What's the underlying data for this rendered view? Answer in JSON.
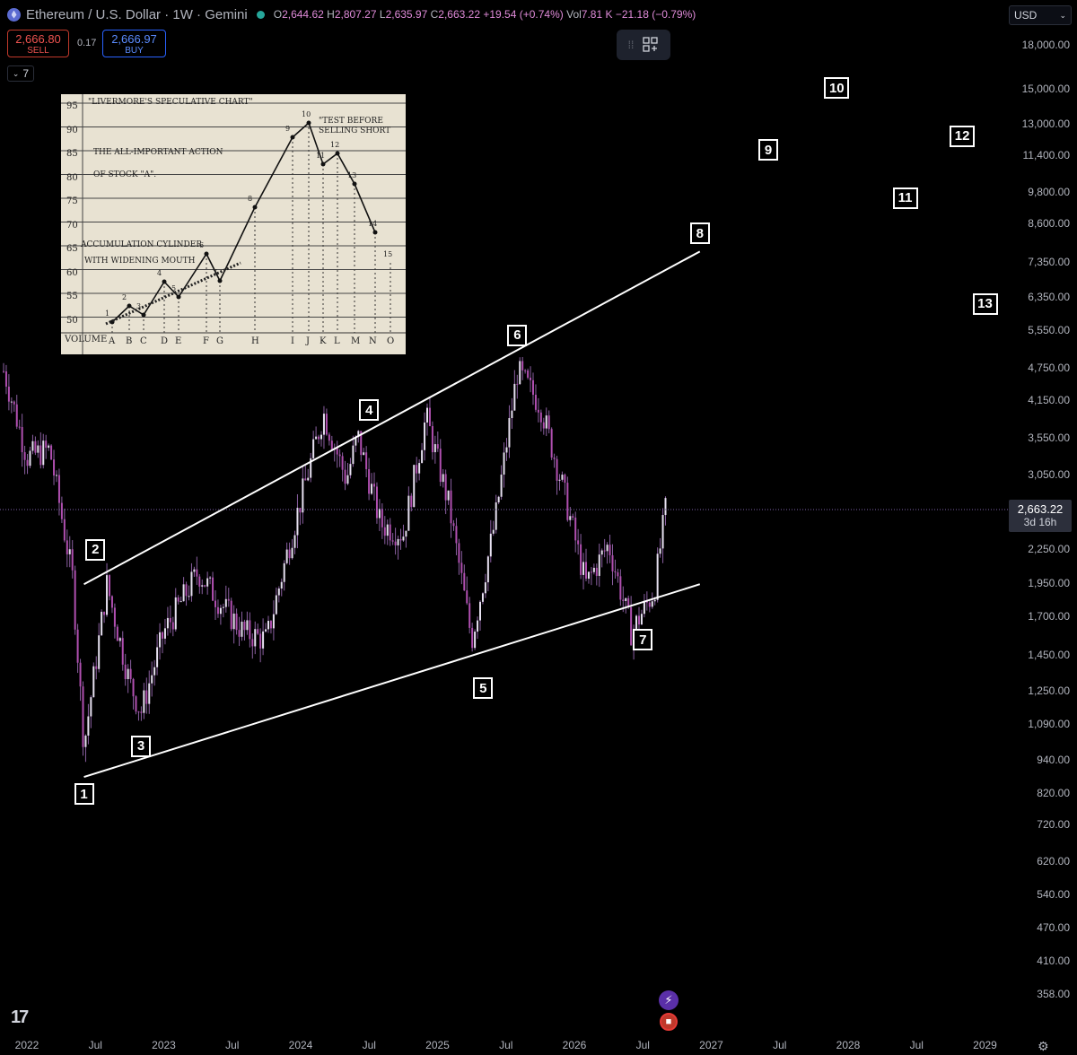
{
  "header": {
    "title": "Ethereum / U.S. Dollar · 1W · Gemini",
    "open_label": "O",
    "open": "2,644.62",
    "high_label": "H",
    "high": "2,807.27",
    "low_label": "L",
    "low": "2,635.97",
    "close_label": "C",
    "close": "2,663.22",
    "change": "+19.54 (+0.74%)",
    "vol_label": "Vol",
    "vol": "7.81 K",
    "vol_change": "−21.18 (−0.79%)"
  },
  "trade": {
    "sell_price": "2,666.80",
    "sell_label": "SELL",
    "spread": "0.17",
    "buy_price": "2,666.97",
    "buy_label": "BUY"
  },
  "indicators_count": "7",
  "currency": "USD",
  "current_price": {
    "value": "2,663.22",
    "countdown": "3d 16h"
  },
  "colors": {
    "background": "#000000",
    "candle": "#b04fb0",
    "line": "#ffffff",
    "accent": "#2962ff"
  },
  "chart_data": {
    "type": "candlestick",
    "y_scale": "log",
    "y_ticks": [
      "18,000.00",
      "15,000.00",
      "13,000.00",
      "11,400.00",
      "9,800.00",
      "8,600.00",
      "7,350.00",
      "6,350.00",
      "5,550.00",
      "4,750.00",
      "4,150.00",
      "3,550.00",
      "3,050.00",
      "2,250.00",
      "1,950.00",
      "1,700.00",
      "1,450.00",
      "1,250.00",
      "1,090.00",
      "940.00",
      "820.00",
      "720.00",
      "620.00",
      "540.00",
      "470.00",
      "410.00",
      "358.00"
    ],
    "x_ticks": [
      "2022",
      "Jul",
      "2023",
      "Jul",
      "2024",
      "Jul",
      "2025",
      "Jul",
      "2026",
      "Jul",
      "2027",
      "Jul",
      "2028",
      "Jul",
      "2029"
    ],
    "price_path": [
      [
        "2021-11",
        4700
      ],
      [
        "2022-01",
        3300
      ],
      [
        "2022-03",
        3400
      ],
      [
        "2022-05",
        2000
      ],
      [
        "2022-06",
        1000
      ],
      [
        "2022-08",
        1950
      ],
      [
        "2022-10",
        1300
      ],
      [
        "2022-11",
        1150
      ],
      [
        "2023-01",
        1600
      ],
      [
        "2023-04",
        2050
      ],
      [
        "2023-06",
        1800
      ],
      [
        "2023-08",
        1600
      ],
      [
        "2023-10",
        1550
      ],
      [
        "2023-12",
        2300
      ],
      [
        "2024-03",
        3950
      ],
      [
        "2024-05",
        3000
      ],
      [
        "2024-06",
        3600
      ],
      [
        "2024-08",
        2500
      ],
      [
        "2024-10",
        2400
      ],
      [
        "2024-12",
        3900
      ],
      [
        "2025-02",
        2700
      ],
      [
        "2025-04",
        1550
      ],
      [
        "2025-06",
        2500
      ],
      [
        "2025-08",
        4700
      ],
      [
        "2025-10",
        4100
      ],
      [
        "2025-12",
        2900
      ],
      [
        "2026-02",
        1950
      ],
      [
        "2026-04",
        2300
      ],
      [
        "2026-06",
        1600
      ],
      [
        "2026-08",
        1900
      ],
      [
        "2026-09",
        2663
      ]
    ],
    "trend_lines": [
      {
        "name": "upper",
        "from": [
          "2022-06",
          1950
        ],
        "to": [
          "2026-12",
          7700
        ]
      },
      {
        "name": "lower",
        "from": [
          "2022-06",
          880
        ],
        "to": [
          "2026-12",
          1950
        ]
      }
    ],
    "wave_labels": [
      {
        "label": "1",
        "date": "2022-06",
        "price": 820
      },
      {
        "label": "2",
        "date": "2022-07",
        "price": 2250
      },
      {
        "label": "3",
        "date": "2022-11",
        "price": 1000
      },
      {
        "label": "4",
        "date": "2024-07",
        "price": 4000
      },
      {
        "label": "5",
        "date": "2025-05",
        "price": 1270
      },
      {
        "label": "6",
        "date": "2025-08",
        "price": 5450
      },
      {
        "label": "7",
        "date": "2026-07",
        "price": 1550
      },
      {
        "label": "8",
        "date": "2026-12",
        "price": 8300
      },
      {
        "label": "9",
        "date": "2027-06",
        "price": 11700
      },
      {
        "label": "10",
        "date": "2027-12",
        "price": 15100
      },
      {
        "label": "11",
        "date": "2028-06",
        "price": 9600
      },
      {
        "label": "12",
        "date": "2028-11",
        "price": 12400
      },
      {
        "label": "13",
        "date": "2029-01",
        "price": 6200
      }
    ]
  },
  "inset": {
    "title": "\"LIVERMORE'S SPECULATIVE CHART\"",
    "note1": "\"TEST BEFORE",
    "note2": "SELLING SHORT",
    "line1": "THE ALL-IMPORTANT ACTION",
    "line2": "OF STOCK \"A\".",
    "line3": "ACCUMULATION CYLINDER",
    "line4": "WITH WIDENING MOUTH",
    "volume": "VOLUME",
    "y_labels": [
      "95",
      "90",
      "85",
      "80",
      "75",
      "70",
      "65",
      "60",
      "55",
      "50"
    ],
    "x_letters": [
      "A",
      "B",
      "C",
      "D",
      "E",
      "F",
      "G",
      "H",
      "I",
      "J",
      "K",
      "L",
      "M",
      "N",
      "O"
    ],
    "point_numbers": [
      "1",
      "2",
      "3",
      "4",
      "5",
      "6",
      "7",
      "8",
      "9",
      "10",
      "11",
      "12",
      "13",
      "14",
      "15"
    ]
  }
}
